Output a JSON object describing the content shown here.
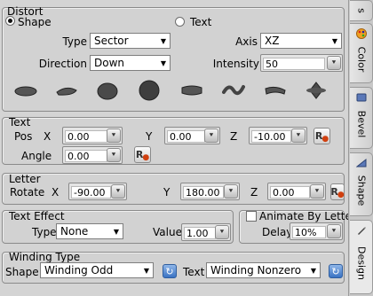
{
  "distort": {
    "title": "Distort",
    "radio_shape": "Shape",
    "radio_text": "Text",
    "type_label": "Type",
    "type_value": "Sector",
    "axis_label": "Axis",
    "axis_value": "XZ",
    "direction_label": "Direction",
    "direction_value": "Down",
    "intensity_label": "Intensity",
    "intensity_value": "50"
  },
  "text": {
    "title": "Text",
    "pos_label": "Pos",
    "x_label": "X",
    "x_value": "0.00",
    "y_label": "Y",
    "y_value": "0.00",
    "z_label": "Z",
    "z_value": "-10.00",
    "angle_label": "Angle",
    "angle_value": "0.00"
  },
  "letter": {
    "title": "Letter",
    "rotate_label": "Rotate",
    "x_label": "X",
    "x_value": "-90.00",
    "y_label": "Y",
    "y_value": "180.00",
    "z_label": "Z",
    "z_value": "0.00"
  },
  "text_effect": {
    "title": "Text Effect",
    "type_label": "Type",
    "type_value": "None",
    "value_label": "Value",
    "value_value": "1.00"
  },
  "animate": {
    "label": "Animate By Letter",
    "delay_label": "Delay",
    "delay_value": "10%"
  },
  "winding": {
    "title": "Winding Type",
    "shape_label": "Shape",
    "shape_value": "Winding Odd",
    "text_label": "Text",
    "text_value": "Winding Nonzero"
  },
  "tabs": {
    "top": "s",
    "color": "Color",
    "bevel": "Bevel",
    "shape": "Shape",
    "design": "Design"
  },
  "icons": {
    "reset": "R"
  }
}
